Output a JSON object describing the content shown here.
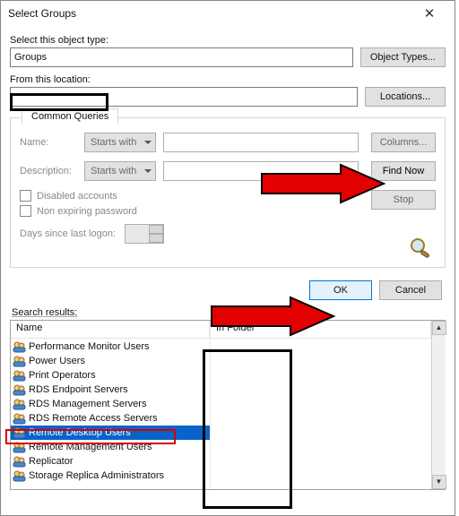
{
  "dialog": {
    "title": "Select Groups",
    "close": "✕"
  },
  "object_type": {
    "label": "Select this object type:",
    "value": "Groups",
    "button": "Object Types..."
  },
  "location": {
    "label": "From this location:",
    "value": "",
    "button": "Locations..."
  },
  "queries": {
    "tab": "Common Queries",
    "name_label": "Name:",
    "desc_label": "Description:",
    "starts_with": "Starts with",
    "disabled": "Disabled accounts",
    "nonexp": "Non expiring password",
    "days_label": "Days since last logon:",
    "columns": "Columns...",
    "find_now": "Find Now",
    "stop": "Stop"
  },
  "footer": {
    "ok": "OK",
    "cancel": "Cancel"
  },
  "results": {
    "label": "Search results:",
    "col_name": "Name",
    "col_folder": "In Folder",
    "items": [
      "Performance Monitor Users",
      "Power Users",
      "Print Operators",
      "RDS Endpoint Servers",
      "RDS Management Servers",
      "RDS Remote Access Servers",
      "Remote Desktop Users",
      "Remote Management Users",
      "Replicator",
      "Storage Replica Administrators"
    ],
    "selected_index": 6
  }
}
